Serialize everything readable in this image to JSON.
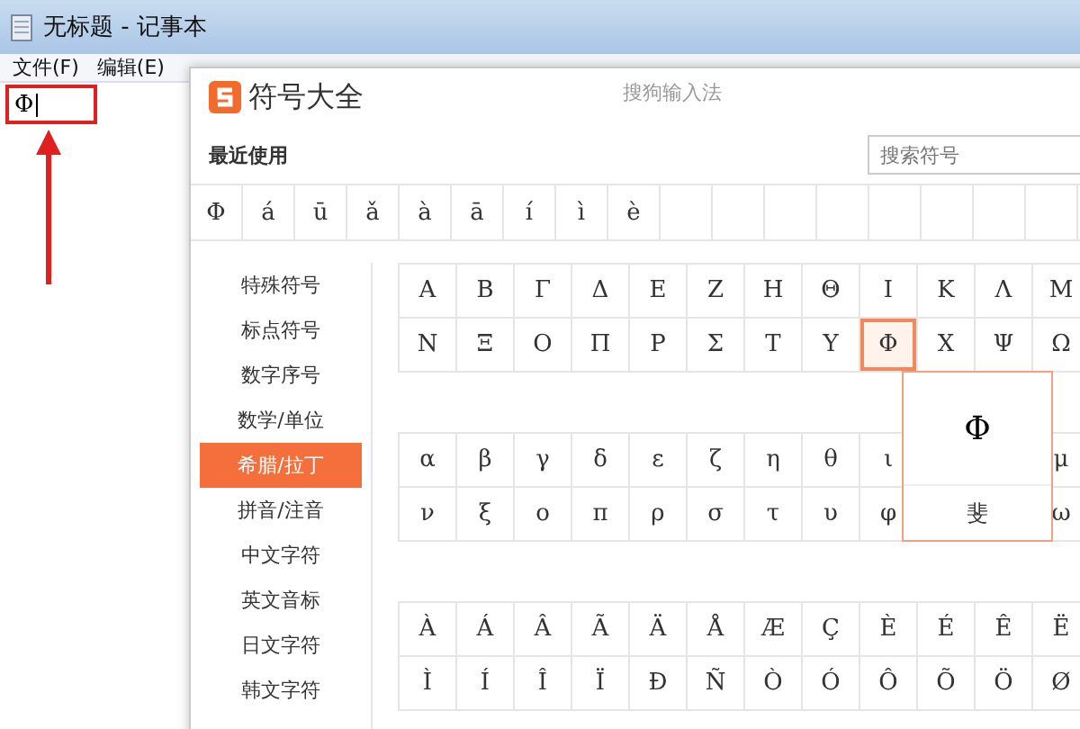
{
  "window": {
    "title": "无标题 - 记事本"
  },
  "menu": [
    "文件(F)",
    "编辑(E)"
  ],
  "editor": {
    "text": "Φ"
  },
  "symbol_panel": {
    "title": "符号大全",
    "ime": "搜狗输入法",
    "recent_label": "最近使用",
    "search": {
      "placeholder": "搜索符号"
    },
    "recent": [
      "Φ",
      "á",
      "ū",
      "ǎ",
      "à",
      "ā",
      "í",
      "ì",
      "è"
    ],
    "categories": [
      {
        "label": "特殊符号",
        "selected": false
      },
      {
        "label": "标点符号",
        "selected": false
      },
      {
        "label": "数字序号",
        "selected": false
      },
      {
        "label": "数学/单位",
        "selected": false
      },
      {
        "label": "希腊/拉丁",
        "selected": true
      },
      {
        "label": "拼音/注音",
        "selected": false
      },
      {
        "label": "中文字符",
        "selected": false
      },
      {
        "label": "英文音标",
        "selected": false
      },
      {
        "label": "日文字符",
        "selected": false
      },
      {
        "label": "韩文字符",
        "selected": false
      }
    ],
    "groups": [
      {
        "rows": [
          [
            {
              "c": "Α",
              "selected": false
            },
            {
              "c": "Β",
              "selected": false
            },
            {
              "c": "Γ",
              "selected": false
            },
            {
              "c": "Δ",
              "selected": false
            },
            {
              "c": "Ε",
              "selected": false
            },
            {
              "c": "Ζ",
              "selected": false
            },
            {
              "c": "Η",
              "selected": false
            },
            {
              "c": "Θ",
              "selected": false
            },
            {
              "c": "Ι",
              "selected": false
            },
            {
              "c": "Κ",
              "selected": false
            },
            {
              "c": "Λ",
              "selected": false
            },
            {
              "c": "Μ",
              "selected": false
            }
          ],
          [
            {
              "c": "Ν",
              "selected": false
            },
            {
              "c": "Ξ",
              "selected": false
            },
            {
              "c": "Ο",
              "selected": false
            },
            {
              "c": "Π",
              "selected": false
            },
            {
              "c": "Ρ",
              "selected": false
            },
            {
              "c": "Σ",
              "selected": false
            },
            {
              "c": "Τ",
              "selected": false
            },
            {
              "c": "Υ",
              "selected": false
            },
            {
              "c": "Φ",
              "selected": true
            },
            {
              "c": "Χ",
              "selected": false
            },
            {
              "c": "Ψ",
              "selected": false
            },
            {
              "c": "Ω",
              "selected": false
            }
          ]
        ]
      },
      {
        "rows": [
          [
            {
              "c": "α",
              "selected": false
            },
            {
              "c": "β",
              "selected": false
            },
            {
              "c": "γ",
              "selected": false
            },
            {
              "c": "δ",
              "selected": false
            },
            {
              "c": "ε",
              "selected": false
            },
            {
              "c": "ζ",
              "selected": false
            },
            {
              "c": "η",
              "selected": false
            },
            {
              "c": "θ",
              "selected": false
            },
            {
              "c": "ι",
              "selected": false
            },
            null,
            null,
            {
              "c": "μ",
              "selected": false
            }
          ],
          [
            {
              "c": "ν",
              "selected": false
            },
            {
              "c": "ξ",
              "selected": false
            },
            {
              "c": "ο",
              "selected": false
            },
            {
              "c": "π",
              "selected": false
            },
            {
              "c": "ρ",
              "selected": false
            },
            {
              "c": "σ",
              "selected": false
            },
            {
              "c": "τ",
              "selected": false
            },
            {
              "c": "υ",
              "selected": false
            },
            {
              "c": "φ",
              "selected": false
            },
            null,
            null,
            {
              "c": "ω",
              "selected": false
            }
          ]
        ]
      },
      {
        "rows": [
          [
            {
              "c": "À",
              "selected": false
            },
            {
              "c": "Á",
              "selected": false
            },
            {
              "c": "Â",
              "selected": false
            },
            {
              "c": "Ã",
              "selected": false
            },
            {
              "c": "Ä",
              "selected": false
            },
            {
              "c": "Å",
              "selected": false
            },
            {
              "c": "Æ",
              "selected": false
            },
            {
              "c": "Ç",
              "selected": false
            },
            {
              "c": "È",
              "selected": false
            },
            {
              "c": "É",
              "selected": false
            },
            {
              "c": "Ê",
              "selected": false
            },
            {
              "c": "Ë",
              "selected": false
            }
          ],
          [
            {
              "c": "Ì",
              "selected": false
            },
            {
              "c": "Í",
              "selected": false
            },
            {
              "c": "Î",
              "selected": false
            },
            {
              "c": "Ï",
              "selected": false
            },
            {
              "c": "Ð",
              "selected": false
            },
            {
              "c": "Ñ",
              "selected": false
            },
            {
              "c": "Ò",
              "selected": false
            },
            {
              "c": "Ó",
              "selected": false
            },
            {
              "c": "Ô",
              "selected": false
            },
            {
              "c": "Õ",
              "selected": false
            },
            {
              "c": "Ö",
              "selected": false
            },
            {
              "c": "Ø",
              "selected": false
            }
          ]
        ]
      }
    ],
    "popup": {
      "char": "Φ",
      "reading": "斐"
    }
  }
}
